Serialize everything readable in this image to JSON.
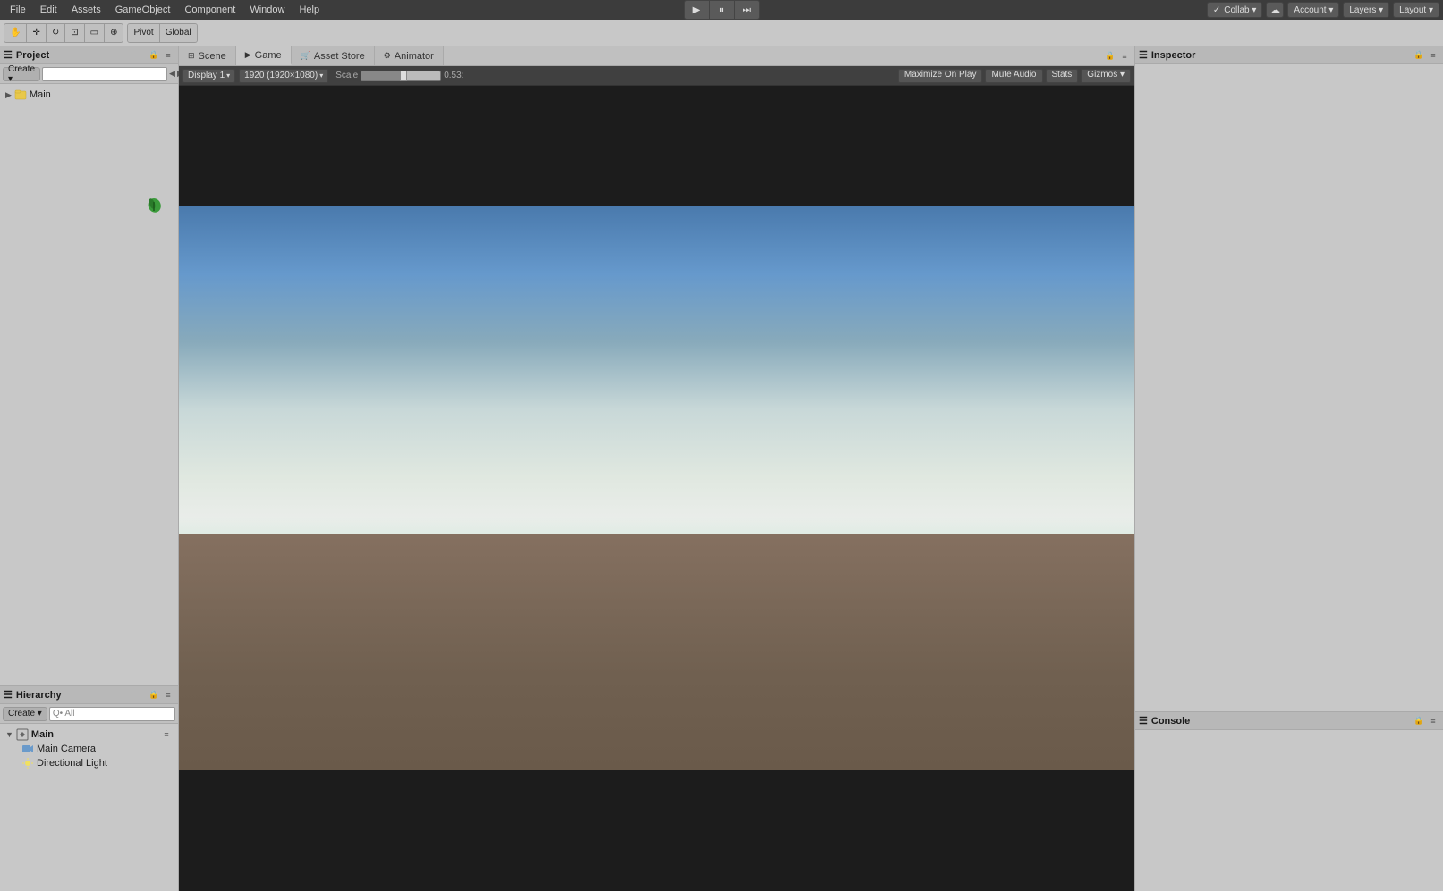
{
  "menubar": {
    "items": [
      "File",
      "Edit",
      "Assets",
      "GameObject",
      "Component",
      "Window",
      "Help"
    ]
  },
  "toolbar": {
    "tools": [
      "hand",
      "move",
      "rotate",
      "scale",
      "rect",
      "all"
    ],
    "pivot_label": "Pivot",
    "global_label": "Global",
    "play_pause_stop": [
      "▶",
      "⏸",
      "⏭"
    ],
    "collab_label": "Collab ▾",
    "account_label": "Account ▾",
    "layers_label": "Layers ▾",
    "layout_label": "Layout ▾",
    "cloud_icon": "☁"
  },
  "tabs": {
    "scene": {
      "label": "Scene",
      "icon": "⊞"
    },
    "game": {
      "label": "Game",
      "icon": "▶",
      "active": true
    },
    "asset_store": {
      "label": "Asset Store",
      "icon": "🛒"
    },
    "animator": {
      "label": "Animator",
      "icon": "⚙"
    }
  },
  "game_toolbar": {
    "display_label": "Display 1",
    "resolution_label": "1920 (1920×1080)",
    "scale_label": "Scale",
    "scale_value": "0.53:",
    "maximize_on_play": "Maximize On Play",
    "mute_audio": "Mute Audio",
    "stats": "Stats",
    "gizmos": "Gizmos ▾"
  },
  "project_panel": {
    "title": "Project",
    "create_label": "Create ▾",
    "search_placeholder": "",
    "items": [
      "Main"
    ]
  },
  "hierarchy_panel": {
    "title": "Hierarchy",
    "create_label": "Create ▾",
    "search_placeholder": "Q• All",
    "items": [
      "Main",
      "Main Camera",
      "Directional Light"
    ]
  },
  "inspector_panel": {
    "title": "Inspector"
  },
  "console_panel": {
    "title": "Console"
  },
  "game_view": {
    "description": "Game view showing sky and ground with letterbox"
  }
}
